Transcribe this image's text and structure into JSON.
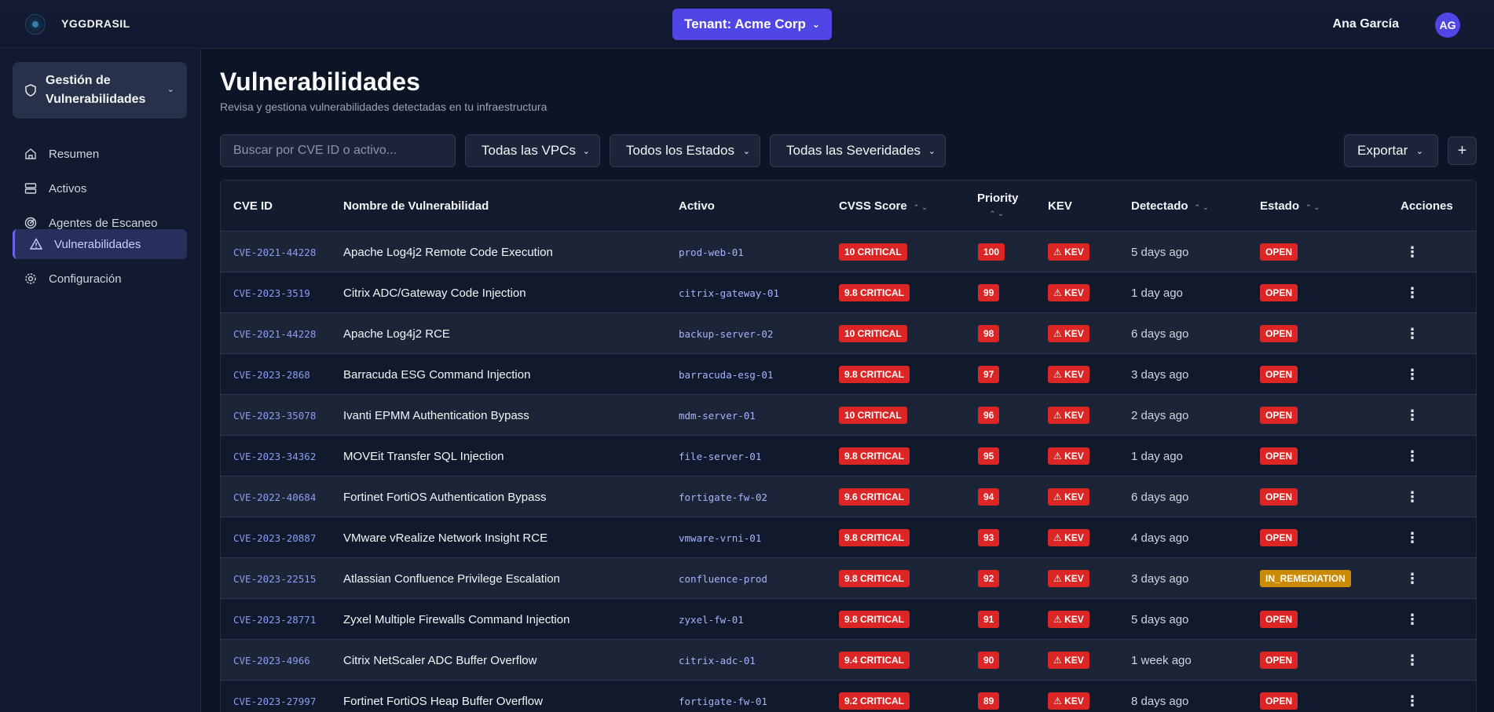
{
  "header": {
    "brand": "YGGDRASIL",
    "tenant_label": "Tenant: Acme Corp",
    "user_name": "Ana García",
    "user_initials": "AG"
  },
  "sidebar": {
    "section_title": "Gestión de Vulnerabilidades",
    "items": [
      {
        "label": "Resumen",
        "icon": "home-icon"
      },
      {
        "label": "Activos",
        "icon": "server-icon"
      },
      {
        "label": "Agentes de Escaneo",
        "icon": "radar-icon"
      },
      {
        "label": "Vulnerabilidades",
        "icon": "warning-icon",
        "active": true
      },
      {
        "label": "Configuración",
        "icon": "gear-icon"
      }
    ]
  },
  "main": {
    "title": "Vulnerabilidades",
    "subtitle": "Revisa y gestiona vulnerabilidades detectadas en tu infraestructura",
    "search_placeholder": "Buscar por CVE ID o activo...",
    "filters": {
      "vpc": "Todas las VPCs",
      "status": "Todos los Estados",
      "severity": "Todas las Severidades"
    },
    "export_label": "Exportar",
    "add_label": "+"
  },
  "table": {
    "columns": {
      "cve": "CVE ID",
      "name": "Nombre de Vulnerabilidad",
      "asset": "Activo",
      "cvss": "CVSS Score",
      "priority": "Priority",
      "kev": "KEV",
      "detected": "Detectado",
      "status": "Estado",
      "actions": "Acciones"
    },
    "kev_label": "⚠ KEV",
    "rows": [
      {
        "cve": "CVE-2021-44228",
        "name": "Apache Log4j2 Remote Code Execution",
        "asset": "prod-web-01",
        "cvss": "10 CRITICAL",
        "priority": "100",
        "detected": "5 days ago",
        "status": "OPEN"
      },
      {
        "cve": "CVE-2023-3519",
        "name": "Citrix ADC/Gateway Code Injection",
        "asset": "citrix-gateway-01",
        "cvss": "9.8 CRITICAL",
        "priority": "99",
        "detected": "1 day ago",
        "status": "OPEN"
      },
      {
        "cve": "CVE-2021-44228",
        "name": "Apache Log4j2 RCE",
        "asset": "backup-server-02",
        "cvss": "10 CRITICAL",
        "priority": "98",
        "detected": "6 days ago",
        "status": "OPEN"
      },
      {
        "cve": "CVE-2023-2868",
        "name": "Barracuda ESG Command Injection",
        "asset": "barracuda-esg-01",
        "cvss": "9.8 CRITICAL",
        "priority": "97",
        "detected": "3 days ago",
        "status": "OPEN"
      },
      {
        "cve": "CVE-2023-35078",
        "name": "Ivanti EPMM Authentication Bypass",
        "asset": "mdm-server-01",
        "cvss": "10 CRITICAL",
        "priority": "96",
        "detected": "2 days ago",
        "status": "OPEN"
      },
      {
        "cve": "CVE-2023-34362",
        "name": "MOVEit Transfer SQL Injection",
        "asset": "file-server-01",
        "cvss": "9.8 CRITICAL",
        "priority": "95",
        "detected": "1 day ago",
        "status": "OPEN"
      },
      {
        "cve": "CVE-2022-40684",
        "name": "Fortinet FortiOS Authentication Bypass",
        "asset": "fortigate-fw-02",
        "cvss": "9.6 CRITICAL",
        "priority": "94",
        "detected": "6 days ago",
        "status": "OPEN"
      },
      {
        "cve": "CVE-2023-20887",
        "name": "VMware vRealize Network Insight RCE",
        "asset": "vmware-vrni-01",
        "cvss": "9.8 CRITICAL",
        "priority": "93",
        "detected": "4 days ago",
        "status": "OPEN"
      },
      {
        "cve": "CVE-2023-22515",
        "name": "Atlassian Confluence Privilege Escalation",
        "asset": "confluence-prod",
        "cvss": "9.8 CRITICAL",
        "priority": "92",
        "detected": "3 days ago",
        "status": "IN_REMEDIATION"
      },
      {
        "cve": "CVE-2023-28771",
        "name": "Zyxel Multiple Firewalls Command Injection",
        "asset": "zyxel-fw-01",
        "cvss": "9.8 CRITICAL",
        "priority": "91",
        "detected": "5 days ago",
        "status": "OPEN"
      },
      {
        "cve": "CVE-2023-4966",
        "name": "Citrix NetScaler ADC Buffer Overflow",
        "asset": "citrix-adc-01",
        "cvss": "9.4 CRITICAL",
        "priority": "90",
        "detected": "1 week ago",
        "status": "OPEN"
      },
      {
        "cve": "CVE-2023-27997",
        "name": "Fortinet FortiOS Heap Buffer Overflow",
        "asset": "fortigate-fw-01",
        "cvss": "9.2 CRITICAL",
        "priority": "89",
        "detected": "8 days ago",
        "status": "OPEN"
      }
    ]
  },
  "colors": {
    "accent": "#4f46e5",
    "critical": "#dc2626",
    "remediation": "#ca8a04"
  }
}
